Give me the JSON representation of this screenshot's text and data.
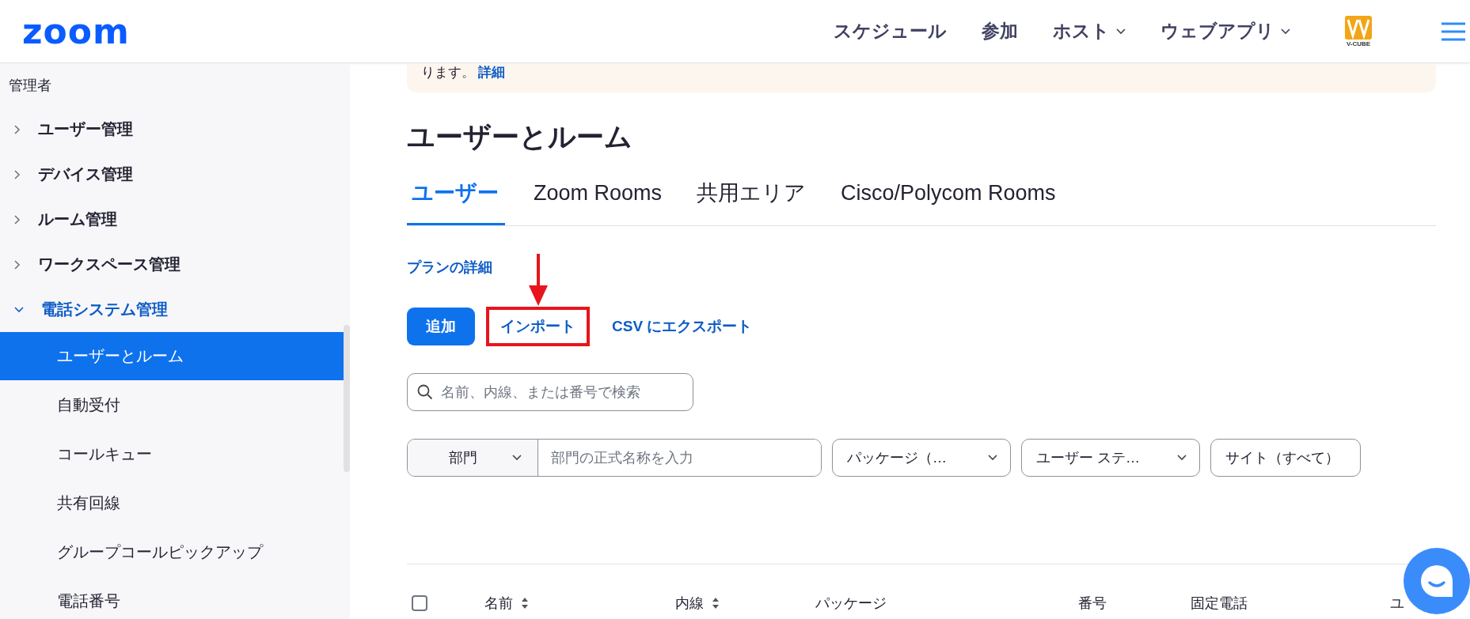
{
  "header": {
    "logo": "zoom",
    "nav": [
      {
        "label": "スケジュール",
        "dropdown": false
      },
      {
        "label": "参加",
        "dropdown": false
      },
      {
        "label": "ホスト",
        "dropdown": true
      },
      {
        "label": "ウェブアプリ",
        "dropdown": true
      }
    ],
    "brand_badge": "V-CUBE"
  },
  "sidebar": {
    "heading": "管理者",
    "items": [
      {
        "label": "ユーザー管理",
        "expanded": false
      },
      {
        "label": "デバイス管理",
        "expanded": false
      },
      {
        "label": "ルーム管理",
        "expanded": false
      },
      {
        "label": "ワークスペース管理",
        "expanded": false
      },
      {
        "label": "電話システム管理",
        "expanded": true,
        "children": [
          {
            "label": "ユーザーとルーム",
            "selected": true
          },
          {
            "label": "自動受付",
            "selected": false
          },
          {
            "label": "コールキュー",
            "selected": false
          },
          {
            "label": "共有回線",
            "selected": false
          },
          {
            "label": "グループコールピックアップ",
            "selected": false
          },
          {
            "label": "電話番号",
            "selected": false
          }
        ]
      }
    ]
  },
  "banner": {
    "text": "ります。",
    "link": "詳細"
  },
  "page_title": "ユーザーとルーム",
  "tabs": [
    {
      "label": "ユーザー",
      "selected": true
    },
    {
      "label": "Zoom Rooms",
      "selected": false
    },
    {
      "label": "共用エリア",
      "selected": false
    },
    {
      "label": "Cisco/Polycom Rooms",
      "selected": false
    }
  ],
  "plan_link": "プランの詳細",
  "actions": [
    {
      "kind": "button",
      "label": "追加",
      "highlighted": false
    },
    {
      "kind": "link",
      "label": "インポート",
      "highlighted": true
    },
    {
      "kind": "link",
      "label": "CSV にエクスポート",
      "highlighted": false
    }
  ],
  "search": {
    "placeholder": "名前、内線、または番号で検索"
  },
  "filters": [
    {
      "kind": "combo",
      "label": "部門",
      "placeholder": "部門の正式名称を入力"
    },
    {
      "kind": "select",
      "label": "パッケージ（…"
    },
    {
      "kind": "select",
      "label": "ユーザー ステ…"
    },
    {
      "kind": "plain",
      "label": "サイト（すべて）"
    }
  ],
  "table": {
    "select_all_checked": false,
    "columns": [
      {
        "label": "名前",
        "sortable": true
      },
      {
        "label": "内線",
        "sortable": true
      },
      {
        "label": "パッケージ",
        "sortable": false
      },
      {
        "label": "番号",
        "sortable": false
      },
      {
        "label": "固定電話",
        "sortable": false
      },
      {
        "label": "ユ",
        "sortable": false
      }
    ]
  }
}
